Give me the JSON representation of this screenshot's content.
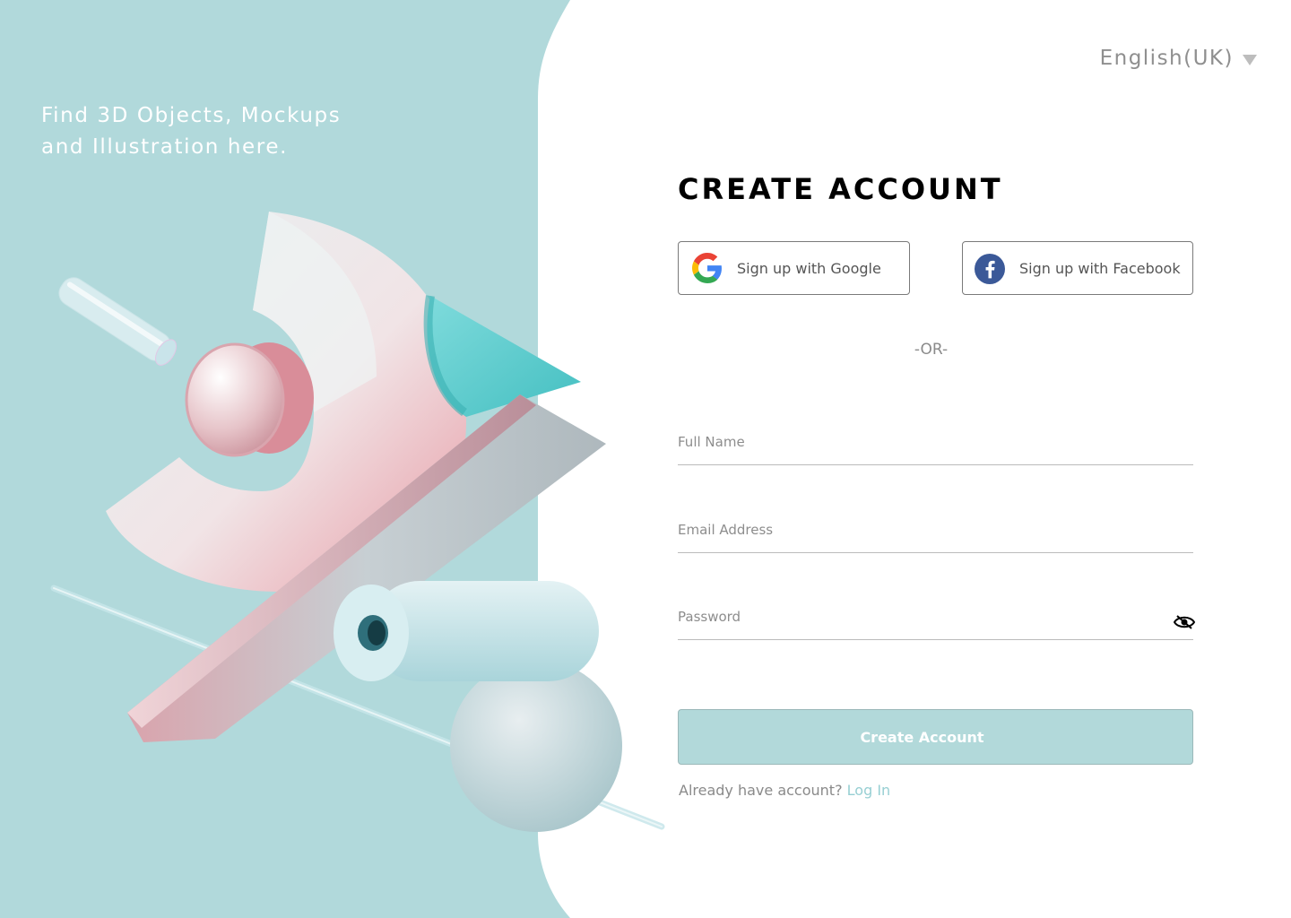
{
  "colors": {
    "panel_teal": "#b1d9db",
    "accent_teal": "#97cfd3",
    "button_bg": "#b2d9da",
    "facebook_blue": "#3b5998"
  },
  "left_panel": {
    "tagline_lines": [
      "Find 3D Objects, Mockups",
      "and Illustration here."
    ],
    "illustration": "abstract-3d-shapes"
  },
  "language": {
    "selected": "English(UK)",
    "icon": "caret-down-icon"
  },
  "form": {
    "title": "CREATE ACCOUNT",
    "google_label": "Sign up with Google",
    "facebook_label": "Sign up with Facebook",
    "or_text": "-OR-",
    "full_name_placeholder": "Full Name",
    "email_placeholder": "Email Address",
    "password_placeholder": "Password",
    "password_icon": "eye-slash-icon",
    "submit_label": "Create Account",
    "login_prompt": "Already have account?",
    "login_link": "Log In"
  }
}
